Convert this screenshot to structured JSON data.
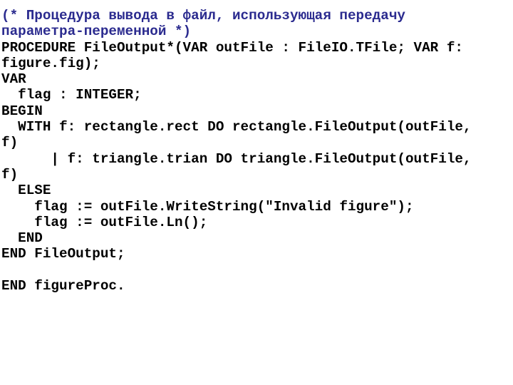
{
  "document": {
    "kind": "source-code-listing",
    "language": "Oberon-2",
    "background_color": "#ffffff",
    "code_color": "#000000",
    "comment_color": "#2b2b8f"
  },
  "code": {
    "lines": [
      {
        "text": "(* Процедура вывода в файл, использующая передачу",
        "style": "comment"
      },
      {
        "text": "параметра-переменной *)",
        "style": "comment"
      },
      {
        "text": "PROCEDURE FileOutput*(VAR outFile : FileIO.TFile; VAR f:",
        "style": "code"
      },
      {
        "text": "figure.fig);",
        "style": "code"
      },
      {
        "text": "VAR",
        "style": "code"
      },
      {
        "text": "  flag : INTEGER;",
        "style": "code"
      },
      {
        "text": "BEGIN",
        "style": "code"
      },
      {
        "text": "  WITH f: rectangle.rect DO rectangle.FileOutput(outFile,",
        "style": "code"
      },
      {
        "text": "f)",
        "style": "code"
      },
      {
        "text": "      | f: triangle.trian DO triangle.FileOutput(outFile,",
        "style": "code"
      },
      {
        "text": "f)",
        "style": "code"
      },
      {
        "text": "  ELSE",
        "style": "code"
      },
      {
        "text": "    flag := outFile.WriteString(\"Invalid figure\");",
        "style": "code"
      },
      {
        "text": "    flag := outFile.Ln();",
        "style": "code"
      },
      {
        "text": "  END",
        "style": "code"
      },
      {
        "text": "END FileOutput;",
        "style": "code"
      },
      {
        "text": "",
        "style": "blank"
      },
      {
        "text": "END figureProc.",
        "style": "code"
      }
    ]
  }
}
